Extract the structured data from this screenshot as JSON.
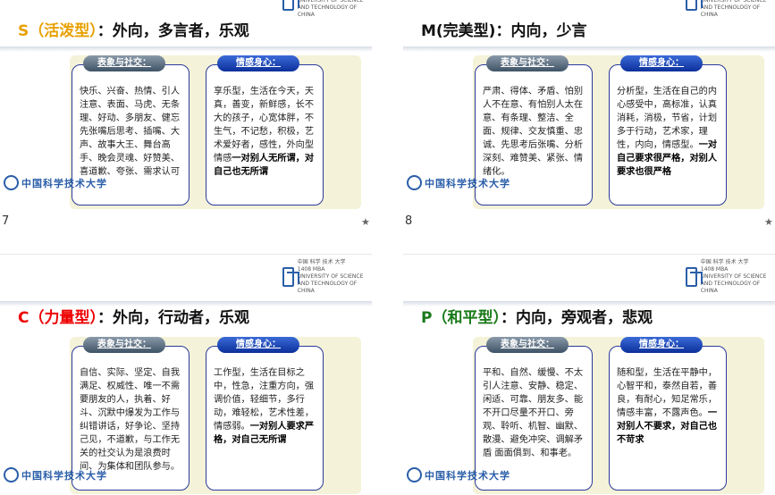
{
  "slides": [
    {
      "key": "S（活泼型）",
      "rest": "：外向，多言者，乐观",
      "key_color": "#e8a000",
      "left_heading": "表象与社交：",
      "right_heading": "情感身心：",
      "left_text": "快乐、兴奋、热情、引人注意、表面、马虎、无条理、好动、多朋友、健忘先张嘴后思考、插嘴、大声、故事大王、舞台高手、晚会灵魂、好赞美、喜道歉、夸张、需求认可",
      "right_text": "享乐型，生活在今天，天真，善变，新鲜感，长不大的孩子，心宽体胖，不生气，不记愁，积极，艺术爱好者，感性，外向型情感",
      "right_bold": "一对别人无所谓，对自己也无所谓",
      "page": "7"
    },
    {
      "key": "M(完美型)",
      "rest": "：内向，少言",
      "key_color": "#111111",
      "left_heading": "表象与社交：",
      "right_heading": "情感身心：",
      "left_text": "严肃、得体、矛盾、怕别人不在意、有怕别人太在意、有条理、整洁、全面、规律、交友慎重、忠诚、先思考后张嘴、分析深刻、难赞美、紧张、情绪化。",
      "right_text": "分析型，生活在自己的内心感受中，高标准，认真消耗，消极，节省，计划多于行动，艺术家，理性，内向，情感型。",
      "right_bold": "一对自己要求很严格，对别人要求也很严格",
      "page": "8"
    },
    {
      "key": "C（力量型）",
      "rest": "：外向，行动者，乐观",
      "key_color": "#ee0000",
      "left_heading": "表象与社交：",
      "right_heading": "情感身心：",
      "left_text": "自信、实际、坚定、自我满足、权威性、唯一不需要朋友的人，执着、好斗、沉默中爆发为工作与纠错讲话，好争论、坚持己见，不道歉，与工作无关的社交认为是浪费时间、为集体和团队参与。",
      "right_text": "工作型，生活在目标之中，性急，注重方向，强调价值，轻细节，多行动，难轻松，艺术性差，情感弱。",
      "right_bold": "一对别人要求严格，对自己无所谓",
      "page": ""
    },
    {
      "key": "P（和平型）",
      "rest": "：内向，旁观者，悲观",
      "key_color": "#1a7a1a",
      "left_heading": "表象与社交：",
      "right_heading": "情感身心：",
      "left_text": "平和、自然、缓慢、不太引人注意、安静、稳定、闲适、可靠、朋友多、能不开口尽量不开口、旁观、聆听、机智、幽默、散漫、避免冲突、调解矛盾 面面俱到、和事老。",
      "right_text": "随和型，生活在平静中，心智平和，泰然自若，善良，有耐心，知足常乐，情感丰富，不露声色。",
      "right_bold": "一对别人不要求，对自己也不苛求",
      "page": ""
    }
  ],
  "logo": {
    "line1": "中国 科学 技术 大学",
    "line2": "1408 MBA",
    "line3": "UNIVERSITY OF SCIENCE AND TECHNOLOGY OF CHINA"
  },
  "footer": {
    "university": "中国科学技术大学"
  },
  "icons": {
    "star": "★"
  }
}
